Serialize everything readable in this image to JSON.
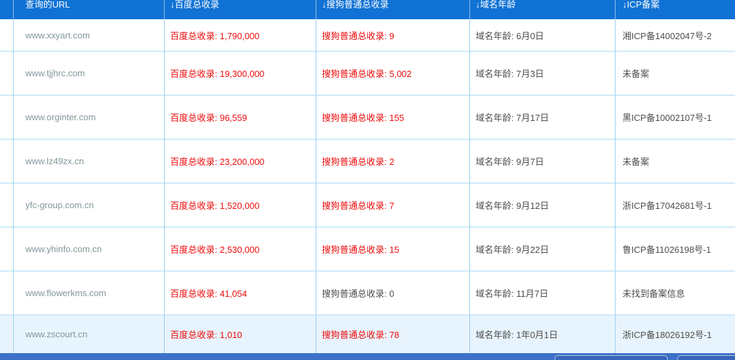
{
  "colors": {
    "header_bg": "#1072d4",
    "header_text": "#ffffff",
    "cell_border_vertical": "#9bd1f5",
    "row_border_horizontal": "#aadaf8",
    "count_red": "#ee0a0a",
    "text_gray": "#4d4d4d",
    "url_text": "#82979b",
    "highlight_row_bg": "#e8f4fd",
    "bottom_bar_bg": "#3d70c7"
  },
  "table": {
    "columns": [
      {
        "label": "查询的URL",
        "sortable": false
      },
      {
        "label": "↓百度总收录",
        "sortable": true
      },
      {
        "label": "↓搜狗普通总收录",
        "sortable": true
      },
      {
        "label": "↓域名年龄",
        "sortable": true
      },
      {
        "label": "↓ICP备案",
        "sortable": true
      }
    ],
    "rows": [
      {
        "url": "www.xxyart.com",
        "baidu": "百度总收录: 1,790,000",
        "baidu_red": true,
        "sogou": "搜狗普通总收录: 9",
        "sogou_red": true,
        "age": "域名年龄: 6月0日",
        "icp": "湘ICP备14002047号-2",
        "highlighted": false
      },
      {
        "url": "www.tjjhrc.com",
        "baidu": "百度总收录: 19,300,000",
        "baidu_red": true,
        "sogou": "搜狗普通总收录: 5,002",
        "sogou_red": true,
        "age": "域名年龄: 7月3日",
        "icp": "未备案",
        "highlighted": false
      },
      {
        "url": "www.orginter.com",
        "baidu": "百度总收录: 96,559",
        "baidu_red": true,
        "sogou": "搜狗普通总收录: 155",
        "sogou_red": true,
        "age": "域名年龄: 7月17日",
        "icp": "黑ICP备10002107号-1",
        "highlighted": false
      },
      {
        "url": "www.lz49zx.cn",
        "baidu": "百度总收录: 23,200,000",
        "baidu_red": true,
        "sogou": "搜狗普通总收录: 2",
        "sogou_red": true,
        "age": "域名年龄: 9月7日",
        "icp": "未备案",
        "highlighted": false
      },
      {
        "url": "yfc-group.com.cn",
        "baidu": "百度总收录: 1,520,000",
        "baidu_red": true,
        "sogou": "搜狗普通总收录: 7",
        "sogou_red": true,
        "age": "域名年龄: 9月12日",
        "icp": "浙ICP备17042681号-1",
        "highlighted": false
      },
      {
        "url": "www.yhinfo.com.cn",
        "baidu": "百度总收录: 2,530,000",
        "baidu_red": true,
        "sogou": "搜狗普通总收录: 15",
        "sogou_red": true,
        "age": "域名年龄: 9月22日",
        "icp": "鲁ICP备11026198号-1",
        "highlighted": false
      },
      {
        "url": "www.flowerkms.com",
        "baidu": "百度总收录: 41,054",
        "baidu_red": true,
        "sogou": "搜狗普通总收录: 0",
        "sogou_red": false,
        "age": "域名年龄: 11月7日",
        "icp": "未找到备案信息",
        "highlighted": false
      },
      {
        "url": "www.zscourt.cn",
        "baidu": "百度总收录: 1,010",
        "baidu_red": true,
        "sogou": "搜狗普通总收录: 78",
        "sogou_red": true,
        "age": "域名年龄: 1年0月1日",
        "icp": "浙ICP备18026192号-1",
        "highlighted": true
      }
    ]
  },
  "bottom_toolbar": {
    "buttons": [
      {
        "label": ""
      },
      {
        "label": ""
      }
    ]
  }
}
